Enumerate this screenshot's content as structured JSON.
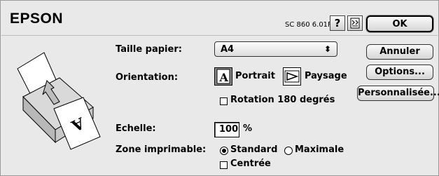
{
  "header": {
    "brand": "EPSON",
    "model_version": "SC 860 6.01F",
    "help_label": "?"
  },
  "buttons": {
    "ok": "OK",
    "annuler": "Annuler",
    "options": "Options...",
    "personnalisee": "Personnalisée..."
  },
  "form": {
    "paper_size_label": "Taille papier:",
    "paper_size_value": "A4",
    "orientation_label": "Orientation:",
    "portrait_label": "Portrait",
    "landscape_label": "Paysage",
    "rotation_label": "Rotation 180 degrés",
    "scale_label": "Echelle:",
    "scale_value": "100",
    "scale_unit": "%",
    "printable_zone_label": "Zone imprimable:",
    "standard_label": "Standard",
    "maximale_label": "Maximale",
    "centree_label": "Centrée"
  },
  "state": {
    "orientation_selected": "Portrait",
    "zone_selected": "Standard",
    "rotation_checked": false,
    "centree_checked": false
  },
  "icons": {
    "help": "question-mark-icon",
    "utility": "utility-icon",
    "portrait": "portrait-orientation-icon",
    "landscape": "landscape-orientation-icon",
    "printer": "printer-illustration"
  }
}
